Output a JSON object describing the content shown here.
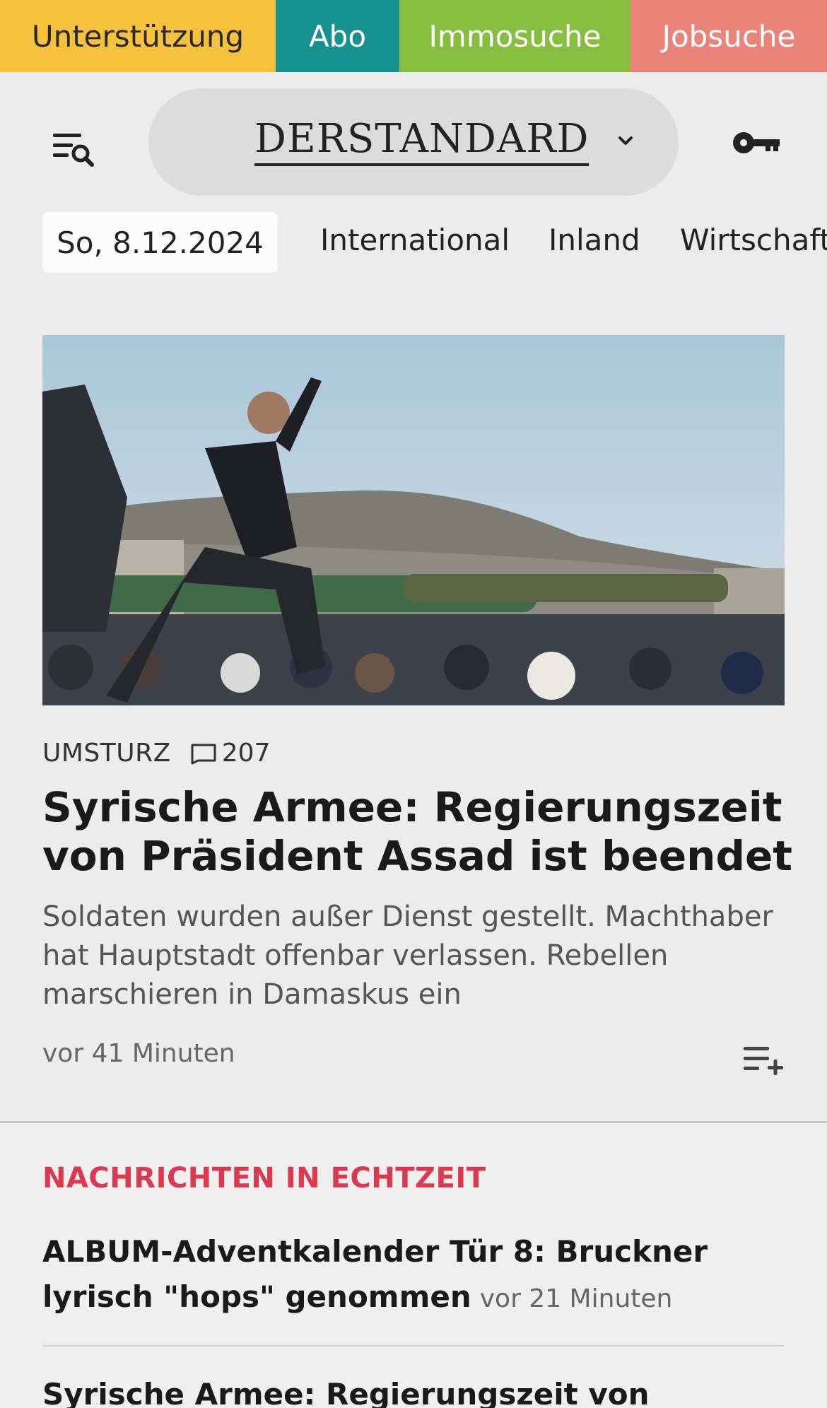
{
  "topnav": {
    "support": "Unterstützung",
    "abo": "Abo",
    "immo": "Immosuche",
    "jobs": "Jobsuche",
    "colors": {
      "support": "#f6c13c",
      "abo": "#17918e",
      "immo": "#86bf3f",
      "jobs": "#ea8379"
    }
  },
  "header": {
    "logo": "DERSTANDARD",
    "icons": {
      "menu": "menu-search-icon",
      "dropdown": "chevron-down-icon",
      "login": "key-icon"
    }
  },
  "ressorts": {
    "date": "So, 8.12.2024",
    "items": [
      "International",
      "Inland",
      "Wirtschaft"
    ]
  },
  "lead": {
    "kicker": "UMSTURZ",
    "comment_count": "207",
    "headline": "Syrische Armee: Regierungszeit von Präsident Assad ist beendet",
    "teaser": "Soldaten wurden außer Dienst gestellt. Machthaber hat Hauptstadt offenbar verlassen. Rebellen marschieren in Damaskus ein",
    "time": "vor 41 Minuten"
  },
  "live": {
    "title": "NACHRICHTEN IN ECHTZEIT",
    "accent": "#d93a4f",
    "items": [
      {
        "headline": "ALBUM-Adventkalender Tür 8: Bruckner lyrisch \"hops\" genommen",
        "time": "vor 21 Minuten"
      },
      {
        "headline": "Syrische Armee: Regierungszeit von Präsident As-",
        "time": ""
      }
    ]
  }
}
